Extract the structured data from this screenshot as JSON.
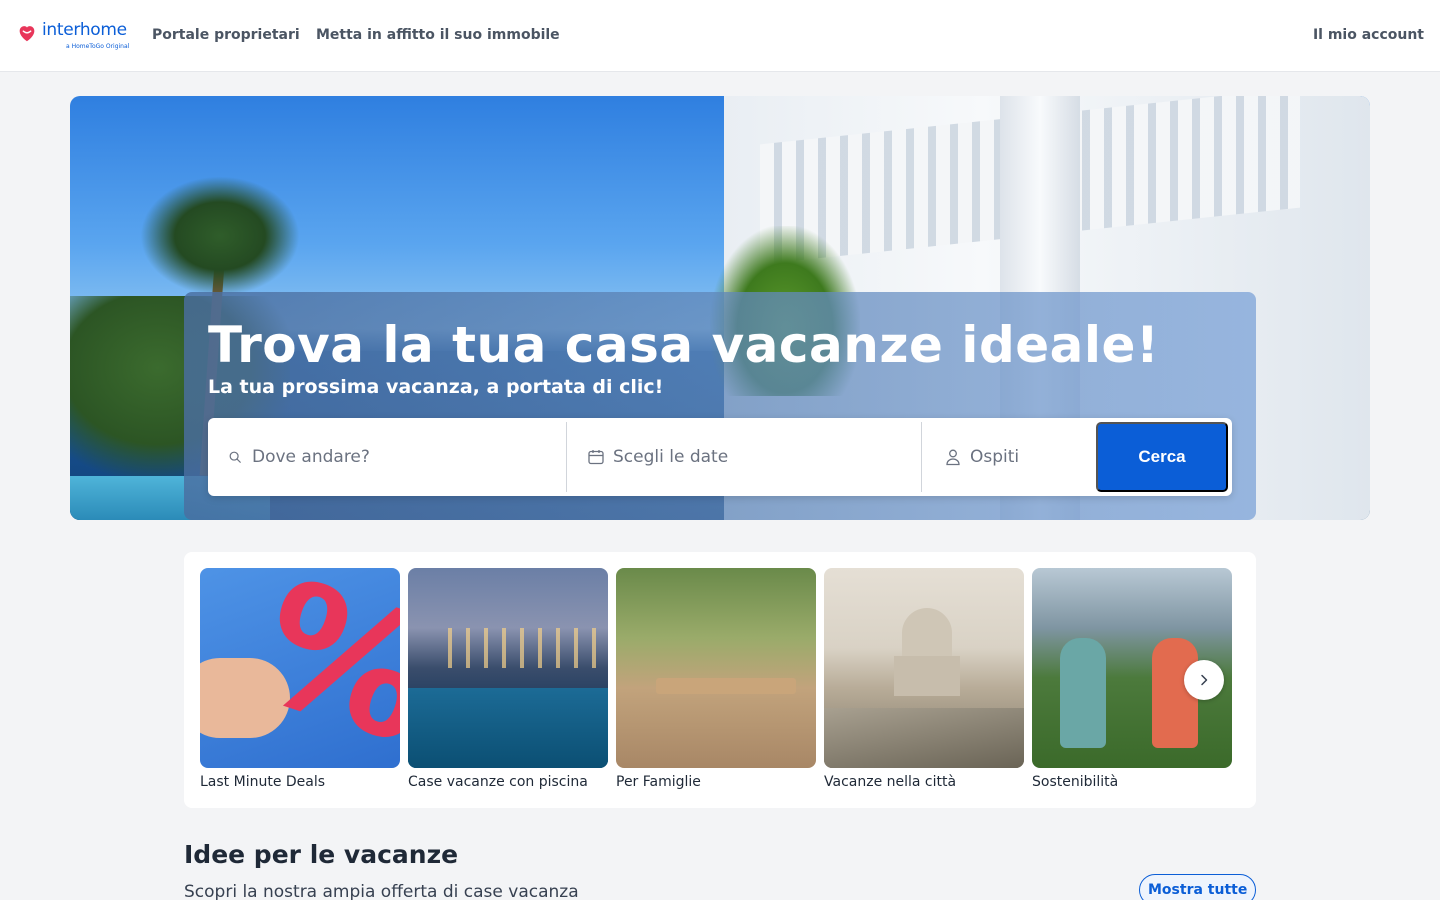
{
  "header": {
    "logo_text": "interhome",
    "logo_tagline": "a HomeToGo Original",
    "nav": {
      "owners_portal": "Portale proprietari",
      "rent_property": "Metta in affitto il suo immobile",
      "account": "Il mio account"
    }
  },
  "hero": {
    "title": "Trova la tua casa vacanze ideale!",
    "subtitle": "La tua prossima vacanza, a portata di clic!",
    "search": {
      "destination_placeholder": "Dove andare?",
      "dates_placeholder": "Scegli le date",
      "guests_placeholder": "Ospiti",
      "button_label": "Cerca"
    }
  },
  "categories": [
    {
      "label": "Last Minute Deals"
    },
    {
      "label": "Case vacanze con piscina"
    },
    {
      "label": "Per Famiglie"
    },
    {
      "label": "Vacanze nella città"
    },
    {
      "label": "Sostenibilità"
    }
  ],
  "ideas": {
    "title": "Idee per le vacanze",
    "subtitle": "Scopri la nostra ampia offerta di case vacanza",
    "show_all": "Mostra tutte"
  },
  "colors": {
    "brand_blue": "#0b5ed7",
    "logo_red": "#e8365a"
  },
  "icons": [
    "heart-logo-icon",
    "search-icon",
    "calendar-icon",
    "user-icon",
    "chevron-right-icon"
  ]
}
